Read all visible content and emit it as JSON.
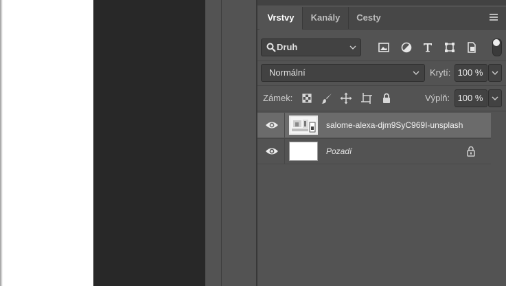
{
  "canvas": {
    "background": "#ffffff",
    "pasteboard": "#282828"
  },
  "panel": {
    "tabs": [
      {
        "label": "Vrstvy",
        "active": true
      },
      {
        "label": "Kanály",
        "active": false
      },
      {
        "label": "Cesty",
        "active": false
      }
    ],
    "menu_icon": "hamburger-menu-icon",
    "filter": {
      "kind_label": "Druh",
      "icons": [
        "image-filter-icon",
        "adjustment-filter-icon",
        "type-filter-icon",
        "shape-filter-icon",
        "smart-object-filter-icon"
      ],
      "toggle_on": true
    },
    "blend": {
      "mode": "Normální",
      "opacity_label": "Krytí:",
      "opacity_value": "100 %"
    },
    "lock": {
      "label": "Zámek:",
      "icons": [
        "lock-transparent-pixels-icon",
        "lock-image-pixels-icon",
        "lock-position-icon",
        "lock-artboard-icon",
        "lock-all-icon"
      ],
      "fill_label": "Výplň:",
      "fill_value": "100 %"
    },
    "layers": [
      {
        "name": "salome-alexa-djm9SyC969I-unsplash",
        "visible": true,
        "selected": true,
        "smart_object": true,
        "locked": false
      },
      {
        "name": "Pozadí",
        "visible": true,
        "selected": false,
        "smart_object": false,
        "locked": true
      }
    ]
  },
  "colors": {
    "panel_bg": "#535353",
    "selected_row": "#6b6b6b",
    "field_bg": "#424242"
  }
}
